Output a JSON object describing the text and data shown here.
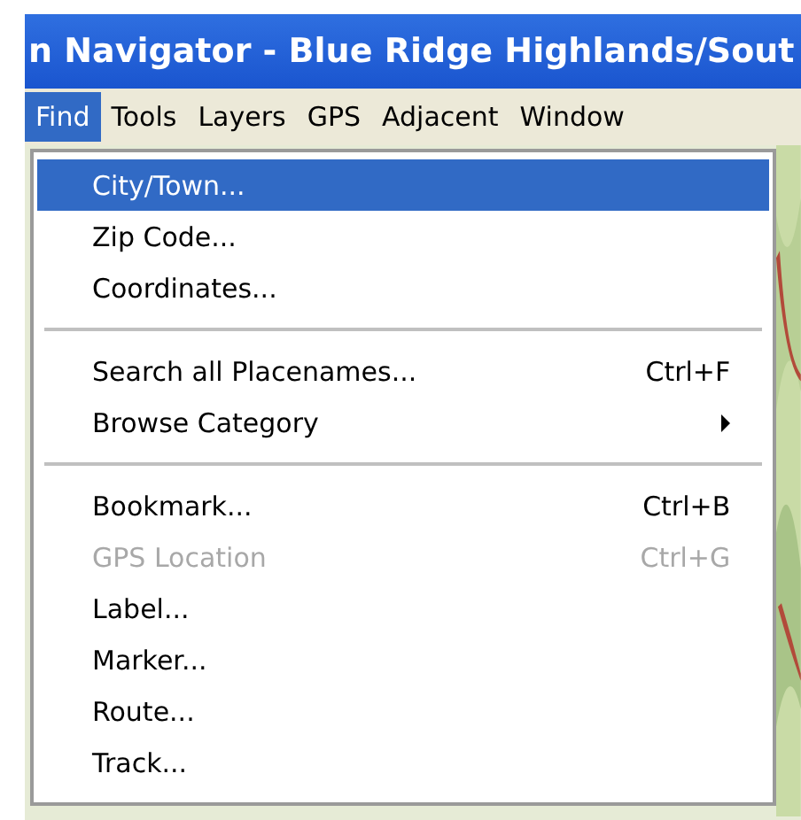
{
  "window": {
    "title": "n Navigator - Blue Ridge Highlands/Sout"
  },
  "menubar": [
    {
      "label": "Find",
      "selected": true
    },
    {
      "label": "Tools",
      "selected": false
    },
    {
      "label": "Layers",
      "selected": false
    },
    {
      "label": "GPS",
      "selected": false
    },
    {
      "label": "Adjacent",
      "selected": false
    },
    {
      "label": "Window",
      "selected": false
    }
  ],
  "menu": {
    "sections": [
      [
        {
          "label": "City/Town...",
          "selected": true,
          "disabled": false,
          "submenu": false
        },
        {
          "label": "Zip Code...",
          "selected": false,
          "disabled": false,
          "submenu": false
        },
        {
          "label": "Coordinates...",
          "selected": false,
          "disabled": false,
          "submenu": false
        }
      ],
      [
        {
          "label": "Search all Placenames...",
          "shortcut": "Ctrl+F",
          "selected": false,
          "disabled": false,
          "submenu": false
        },
        {
          "label": "Browse Category",
          "selected": false,
          "disabled": false,
          "submenu": true
        }
      ],
      [
        {
          "label": "Bookmark...",
          "shortcut": "Ctrl+B",
          "selected": false,
          "disabled": false,
          "submenu": false
        },
        {
          "label": "GPS Location",
          "shortcut": "Ctrl+G",
          "selected": false,
          "disabled": true,
          "submenu": false
        },
        {
          "label": "Label...",
          "selected": false,
          "disabled": false,
          "submenu": false
        },
        {
          "label": "Marker...",
          "selected": false,
          "disabled": false,
          "submenu": false
        },
        {
          "label": "Route...",
          "selected": false,
          "disabled": false,
          "submenu": false
        },
        {
          "label": "Track...",
          "selected": false,
          "disabled": false,
          "submenu": false
        }
      ]
    ]
  }
}
